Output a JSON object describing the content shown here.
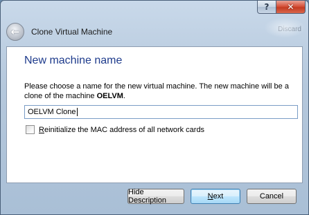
{
  "window": {
    "help_glyph": "?",
    "close_glyph": "✕",
    "background_tab_text": "Discard"
  },
  "wizard": {
    "title": "Clone Virtual Machine",
    "back_glyph": "←"
  },
  "page": {
    "title": "New machine name",
    "description_prefix": "Please choose a name for the new virtual machine. The new machine will be a clone of the machine ",
    "source_machine": "OELVM",
    "description_suffix": "."
  },
  "name_input": {
    "value": "OELVM Clone"
  },
  "mac_checkbox": {
    "checked": false,
    "label_mnemonic": "R",
    "label_rest": "einitialize the MAC address of all network cards"
  },
  "buttons": {
    "hide_description": "Hide Description",
    "next_mnemonic": "N",
    "next_rest": "ext",
    "cancel": "Cancel"
  },
  "colors": {
    "page_title": "#1e3b8c",
    "focus_button_border": "#3c7fb1",
    "close_button": "#c43b22"
  }
}
